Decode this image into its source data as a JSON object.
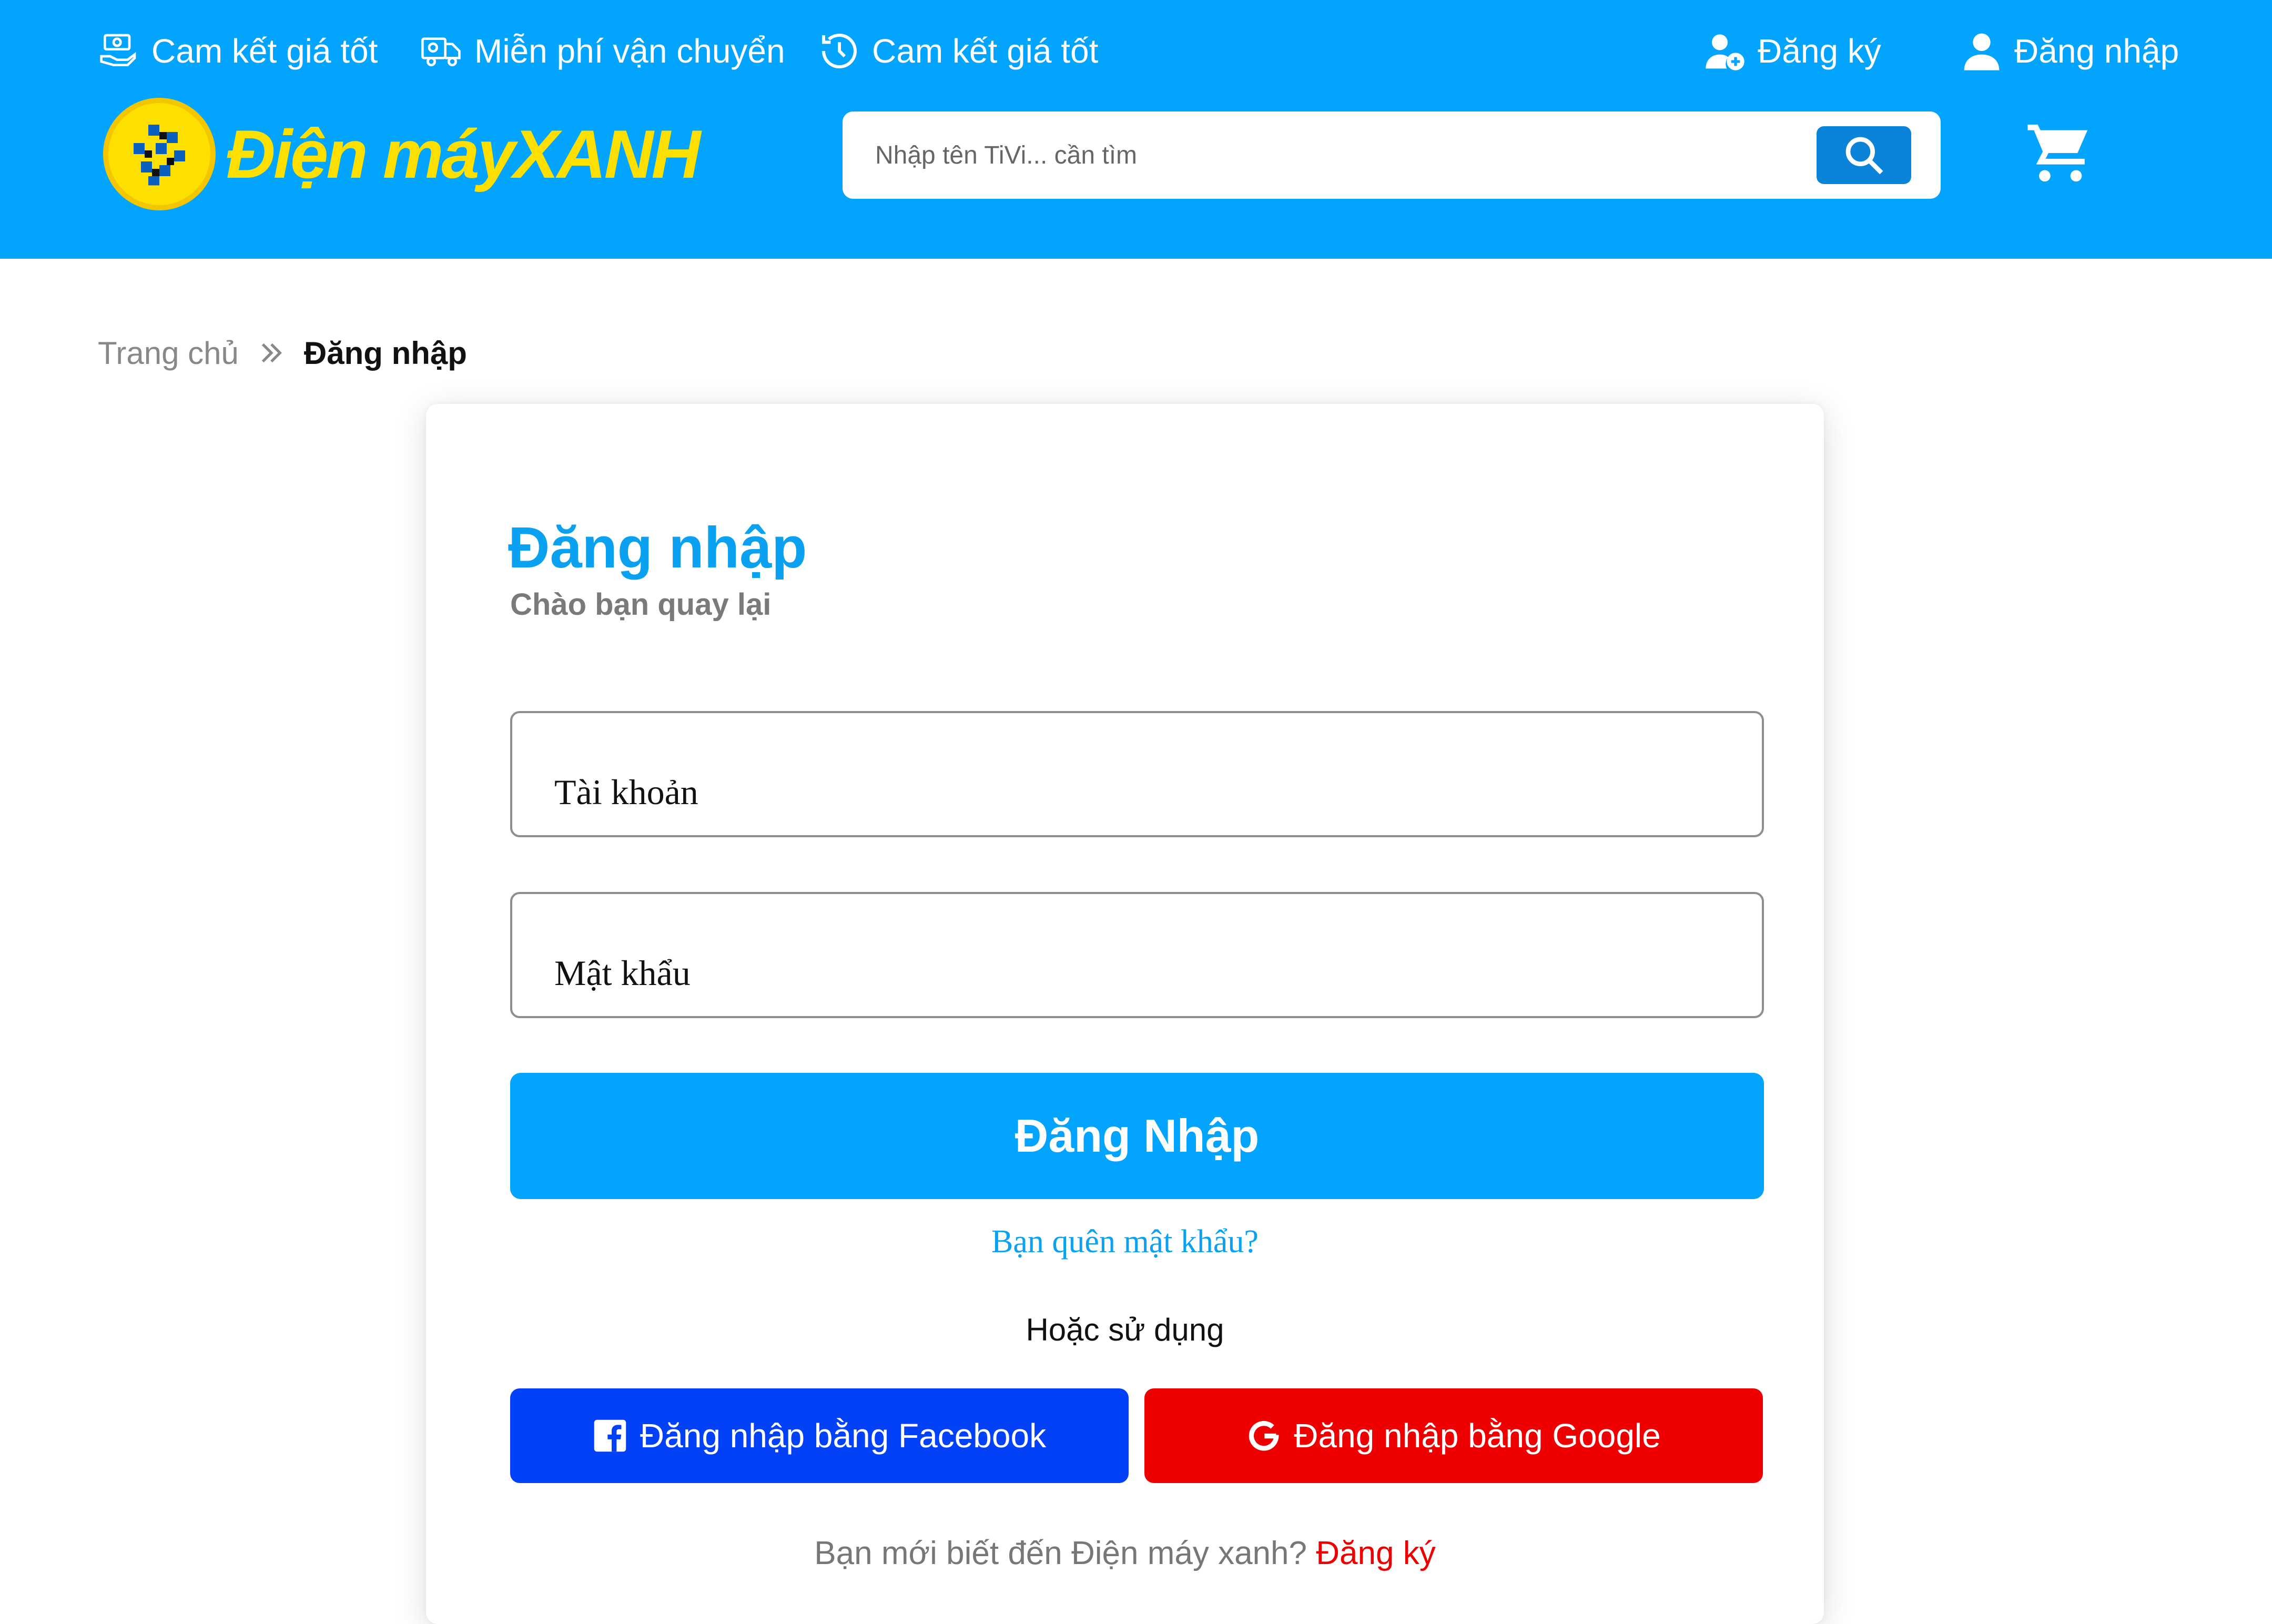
{
  "topbar": {
    "item1": "Cam kết giá tốt",
    "item2": "Miễn phí vận chuyển",
    "item3": "Cam kết giá tốt",
    "register": "Đăng ký",
    "login": "Đăng nhập"
  },
  "logo": {
    "text_main": "Điện máy",
    "text_bold": "XANH"
  },
  "search": {
    "placeholder": "Nhập tên TiVi... cần tìm"
  },
  "breadcrumb": {
    "home": "Trang chủ",
    "separator": "»",
    "current": "Đăng nhập"
  },
  "login_form": {
    "title": "Đăng nhập",
    "subtitle": "Chào bạn quay lại",
    "account_label": "Tài khoản",
    "password_label": "Mật khẩu",
    "submit_label": "Đăng Nhập",
    "forgot_label": "Bạn quên mật khẩu?",
    "or_use": "Hoặc sử dụng",
    "facebook_label": "Đăng nhập bằng Facebook",
    "google_label": "Đăng nhập bằng Google",
    "new_user_text": "Bạn mới biết đến Điện máy xanh?",
    "signup_link": "Đăng ký"
  },
  "colors": {
    "brand_blue": "#03a4fd",
    "search_button": "#0a83d8",
    "facebook": "#0341f7",
    "google": "#ee0000",
    "logo_yellow": "#fde000"
  },
  "icons": [
    "money-hand-icon",
    "truck-icon",
    "history-icon",
    "user-add-icon",
    "user-icon",
    "search-icon",
    "cart-icon",
    "facebook-icon",
    "google-icon",
    "chevron-double-right-icon"
  ]
}
